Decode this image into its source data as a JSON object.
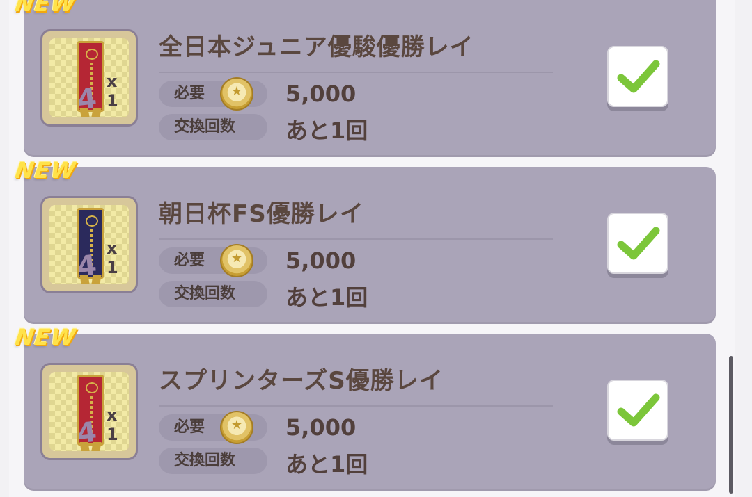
{
  "items": [
    {
      "badge": "NEW",
      "name": "全日本ジュニア優駿優勝レイ",
      "quantity": "x 1",
      "required_label": "必要",
      "cost": "5,000",
      "count_label": "交換回数",
      "remaining": "あと1回",
      "checked": true,
      "sash_color": "#b52634"
    },
    {
      "badge": "NEW",
      "name": "朝日杯FS優勝レイ",
      "quantity": "x 1",
      "required_label": "必要",
      "cost": "5,000",
      "count_label": "交換回数",
      "remaining": "あと1回",
      "checked": true,
      "sash_color": "#2b2a5c"
    },
    {
      "badge": "NEW",
      "name": "スプリンターズS優勝レイ",
      "quantity": "x 1",
      "required_label": "必要",
      "cost": "5,000",
      "count_label": "交換回数",
      "remaining": "あと1回",
      "checked": true,
      "sash_color": "#b52634"
    }
  ],
  "icons": {
    "currency": "horseshoe-coin-icon",
    "check": "checkmark-icon"
  },
  "colors": {
    "card_bg": "#aaa4b8",
    "badge": "#ffe24a",
    "check": "#7cc63a"
  }
}
